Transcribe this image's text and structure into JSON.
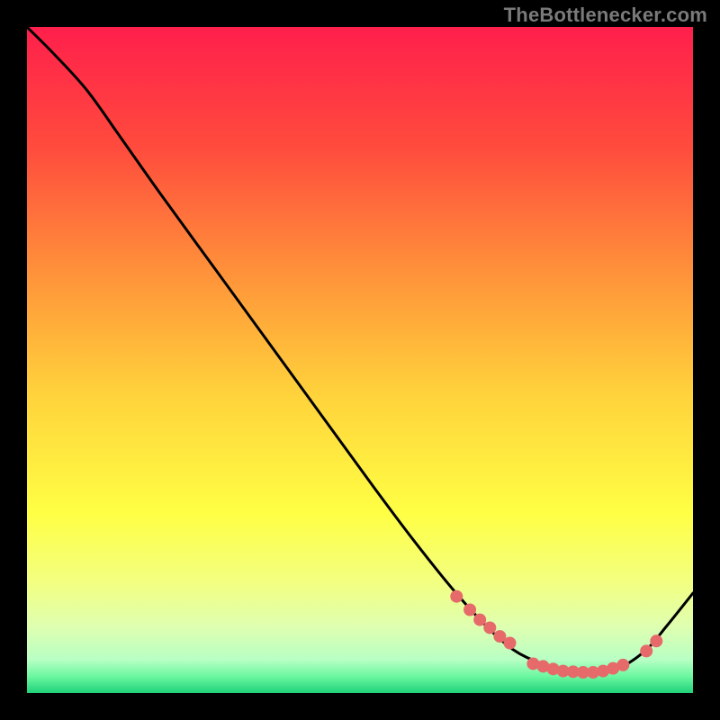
{
  "attribution": "TheBottlenecker.com",
  "chart_data": {
    "type": "line",
    "title": "",
    "xlabel": "",
    "ylabel": "",
    "xlim": [
      0,
      100
    ],
    "ylim": [
      0,
      100
    ],
    "axes_visible": false,
    "background_gradient": {
      "stops": [
        {
          "offset": 0.0,
          "color": "#ff1f4c"
        },
        {
          "offset": 0.18,
          "color": "#ff4b3d"
        },
        {
          "offset": 0.38,
          "color": "#ff963a"
        },
        {
          "offset": 0.55,
          "color": "#ffd23b"
        },
        {
          "offset": 0.73,
          "color": "#ffff44"
        },
        {
          "offset": 0.83,
          "color": "#f3ff7e"
        },
        {
          "offset": 0.9,
          "color": "#dfffb0"
        },
        {
          "offset": 0.95,
          "color": "#b8ffc4"
        },
        {
          "offset": 0.975,
          "color": "#6bf7a0"
        },
        {
          "offset": 1.0,
          "color": "#20d27a"
        }
      ]
    },
    "curve": {
      "x": [
        0,
        4,
        9,
        14,
        20,
        28,
        36,
        44,
        52,
        58,
        64,
        69,
        73,
        77,
        81,
        85,
        89,
        93,
        96,
        100
      ],
      "y": [
        100,
        96,
        90.5,
        83.5,
        75,
        64,
        53,
        42,
        31,
        23,
        15.5,
        10,
        6.5,
        4.5,
        3.2,
        3.0,
        3.8,
        6.5,
        10,
        15
      ]
    },
    "markers": {
      "sequence_a": {
        "x": [
          64.5,
          66.5,
          68.0,
          69.5,
          71.0,
          72.5
        ],
        "y": [
          14.5,
          12.5,
          11.0,
          9.8,
          8.5,
          7.5
        ]
      },
      "sequence_b": {
        "x": [
          76.0,
          77.5,
          79.0,
          80.5,
          82.0,
          83.5,
          85.0,
          86.5,
          88.0,
          89.5
        ],
        "y": [
          4.4,
          4.0,
          3.6,
          3.3,
          3.2,
          3.1,
          3.1,
          3.3,
          3.7,
          4.2
        ]
      },
      "sequence_c": {
        "x": [
          93.0,
          94.5
        ],
        "y": [
          6.3,
          7.8
        ]
      }
    },
    "marker_style": {
      "fill": "#e66a6a",
      "radius": 7
    },
    "curve_style": {
      "stroke": "#000000",
      "width": 3
    }
  }
}
